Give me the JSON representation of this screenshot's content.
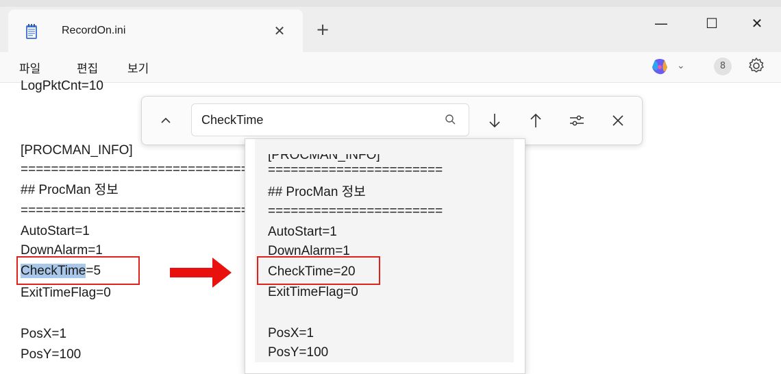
{
  "window": {
    "tab_title": "RecordOn.ini",
    "tab_close": "✕",
    "new_tab": "+",
    "minimize": "—",
    "maximize": "☐",
    "close": "✕"
  },
  "menu": {
    "items": [
      "파일",
      "편집",
      "보기"
    ]
  },
  "toolbar": {
    "copilot_icon": "copilot-icon",
    "account_icon": "account-icon",
    "account_glyph": "8",
    "settings_icon": "gear-icon"
  },
  "find": {
    "value": "CheckTime",
    "placeholder": ""
  },
  "editor": {
    "lines": [
      "LogPktCnt=10",
      "[PROCMAN_INFO]",
      "==========================================================",
      "## ProcMan 정보",
      "==========================================================",
      "AutoStart=1",
      "DownAlarm=1",
      "CheckTime",
      "=5",
      "ExitTimeFlag=0",
      "PosX=1",
      "PosY=100"
    ]
  },
  "popup": {
    "lines": [
      "[PROCMAN_INFO]",
      "=======================",
      "## ProcMan 정보",
      "=======================",
      "AutoStart=1",
      "DownAlarm=1",
      "CheckTime=20",
      "ExitTimeFlag=0",
      "PosX=1",
      "PosY=100"
    ]
  },
  "colors": {
    "selection": "#a9c7e8",
    "annotation_red": "#e0201b"
  }
}
